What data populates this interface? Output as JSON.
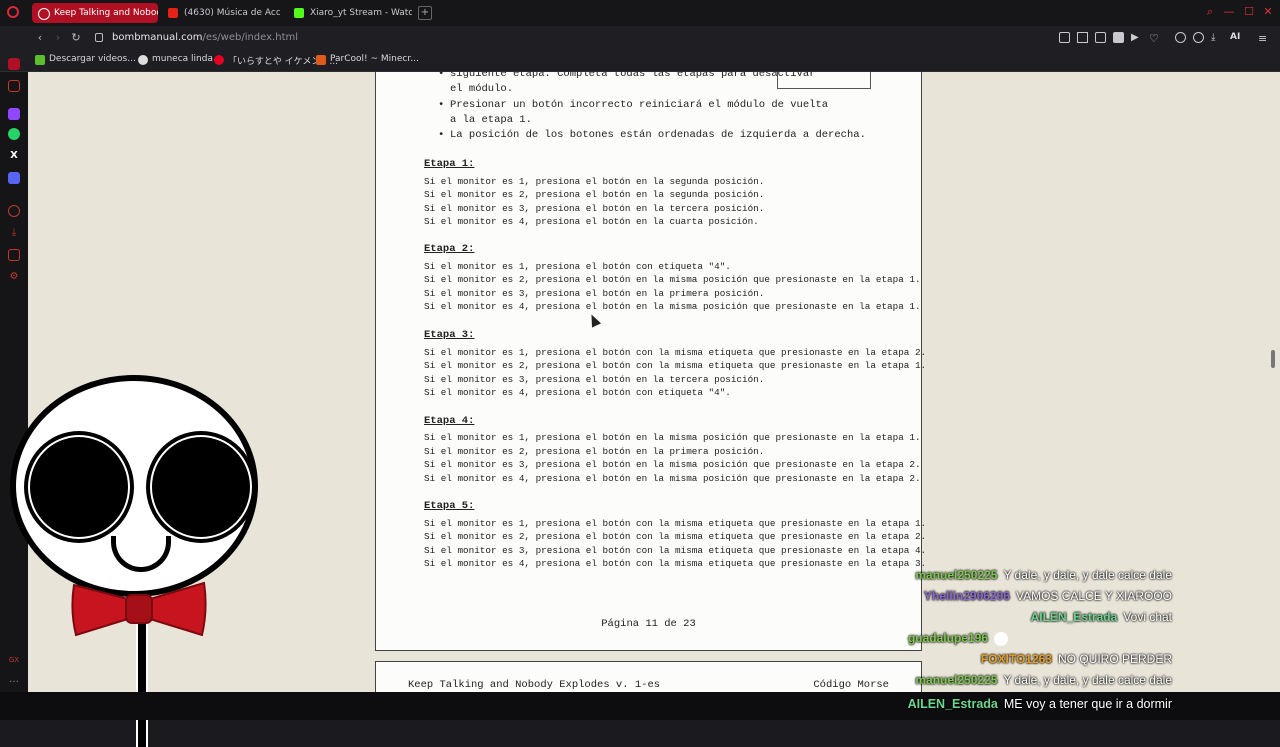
{
  "browser": {
    "tabs": [
      {
        "label": "Keep Talking and Nobody",
        "active": true,
        "color": "#ffffff"
      },
      {
        "label": "(4630) Música de Acc",
        "active": false,
        "color": "#e62117"
      },
      {
        "label": "Xiaro_yt Stream - Watch L",
        "active": false,
        "color": "#53fc18"
      }
    ],
    "new_tab_label": "+",
    "url_host": "bombmanual.com",
    "url_path": "/es/web/index.html",
    "bookmarks": [
      {
        "label": "Descargar videos...",
        "color": "#5bbf2e"
      },
      {
        "label": "muneca linda",
        "color": "#e0e0e0"
      },
      {
        "label": "「いらすとや イケメン」...",
        "color": "#e60023"
      },
      {
        "label": "ParCool! ~ Minecr...",
        "color": "#e05a1c"
      }
    ],
    "extension_label": "AI"
  },
  "manual": {
    "bullets": [
      "siguiente etapa. Completa todas las etapas para desactivar el módulo.",
      "Presionar un botón incorrecto reiniciará el módulo de vuelta a la etapa 1.",
      "La posición de los botones están ordenadas de izquierda a derecha."
    ],
    "stages": [
      {
        "title": "Etapa 1:",
        "lines": [
          "Si el monitor es 1, presiona el botón en la segunda posición.",
          "Si el monitor es 2, presiona el botón en la segunda posición.",
          "Si el monitor es 3, presiona el botón en la tercera posición.",
          "Si el monitor es 4, presiona el botón en la cuarta posición."
        ]
      },
      {
        "title": "Etapa 2:",
        "lines": [
          "Si el monitor es 1, presiona el botón con etiqueta \"4\".",
          "Si el monitor es 2, presiona el botón en la misma posición que presionaste en la etapa 1.",
          "Si el monitor es 3, presiona el botón en la primera posición.",
          "Si el monitor es 4, presiona el botón en la misma posición que presionaste en la etapa 1."
        ]
      },
      {
        "title": "Etapa 3:",
        "lines": [
          "Si el monitor es 1, presiona el botón con la misma etiqueta que presionaste en la etapa 2.",
          "Si el monitor es 2, presiona el botón con la misma etiqueta que presionaste en la etapa 1.",
          "Si el monitor es 3, presiona el botón en la tercera posición.",
          "Si el monitor es 4, presiona el botón con etiqueta \"4\"."
        ]
      },
      {
        "title": "Etapa 4:",
        "lines": [
          "Si el monitor es 1, presiona el botón en la misma posición que presionaste en la etapa 1.",
          "Si el monitor es 2, presiona el botón en la primera posición.",
          "Si el monitor es 3, presiona el botón en la misma posición que presionaste en la etapa 2.",
          "Si el monitor es 4, presiona el botón en la misma posición que presionaste en la etapa 2."
        ]
      },
      {
        "title": "Etapa 5:",
        "lines": [
          "Si el monitor es 1, presiona el botón con la misma etiqueta que presionaste en la etapa 1.",
          "Si el monitor es 2, presiona el botón con la misma etiqueta que presionaste en la etapa 2.",
          "Si el monitor es 3, presiona el botón con la misma etiqueta que presionaste en la etapa 4.",
          "Si el monitor es 4, presiona el botón con la misma etiqueta que presionaste en la etapa 3."
        ]
      }
    ],
    "page_number": "Página 11 de 23",
    "next_page_header_left": "Keep Talking and Nobody Explodes v. 1-es",
    "next_page_header_right": "Código Morse"
  },
  "chat": [
    {
      "user": "manuel250225",
      "text": "Y dale, y dale, y dale calce dale",
      "color": "#7ec850"
    },
    {
      "user": "Yhellin2906206",
      "text": "VAMOS CALCE Y XIAROOO",
      "color": "#8a6ad0"
    },
    {
      "user": "AILEN_Estrada",
      "text": "Vovi chat",
      "color": "#6cd68f"
    },
    {
      "user": "guadalupe196",
      "text": "",
      "color": "#7ec850"
    },
    {
      "user": "FOXITO1263",
      "text": "NO QUIRO PERDER",
      "color": "#e8a020"
    },
    {
      "user": "manuel250225",
      "text": "Y dale, y dale, y dale calce dale",
      "color": "#7ec850"
    }
  ],
  "bottom_chat": {
    "user": "AILEN_Estrada",
    "text": "ME voy a tener que ir a dormir",
    "color": "#6cd68f"
  }
}
